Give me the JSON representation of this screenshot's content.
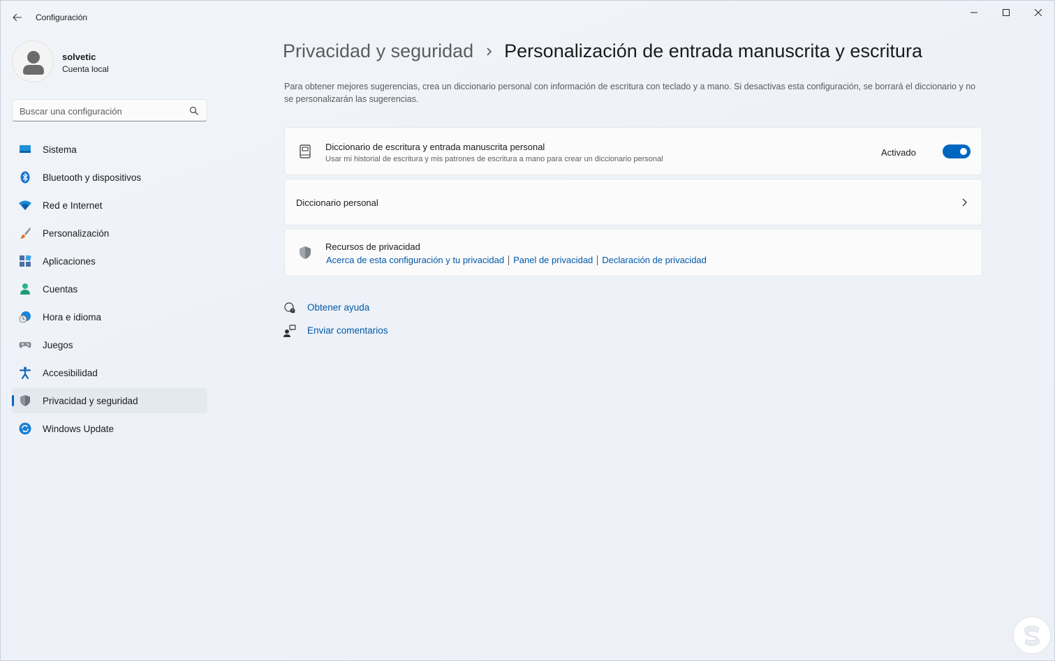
{
  "window": {
    "title": "Configuración"
  },
  "profile": {
    "name": "solvetic",
    "account_type": "Cuenta local"
  },
  "search": {
    "placeholder": "Buscar una configuración"
  },
  "sidebar": {
    "items": [
      {
        "label": "Sistema",
        "icon": "monitor-icon"
      },
      {
        "label": "Bluetooth y dispositivos",
        "icon": "bluetooth-icon"
      },
      {
        "label": "Red e Internet",
        "icon": "wifi-icon"
      },
      {
        "label": "Personalización",
        "icon": "brush-icon"
      },
      {
        "label": "Aplicaciones",
        "icon": "apps-icon"
      },
      {
        "label": "Cuentas",
        "icon": "person-icon"
      },
      {
        "label": "Hora e idioma",
        "icon": "globe-clock-icon"
      },
      {
        "label": "Juegos",
        "icon": "gamepad-icon"
      },
      {
        "label": "Accesibilidad",
        "icon": "accessibility-icon"
      },
      {
        "label": "Privacidad y seguridad",
        "icon": "shield-icon",
        "active": true
      },
      {
        "label": "Windows Update",
        "icon": "sync-icon"
      }
    ]
  },
  "breadcrumb": {
    "parent": "Privacidad y seguridad",
    "current": "Personalización de entrada manuscrita y escritura"
  },
  "description": "Para obtener mejores sugerencias, crea un diccionario personal con información de escritura con teclado y a mano. Si desactivas esta configuración, se borrará el diccionario y no se personalizarán las sugerencias.",
  "settings": {
    "dictionary_toggle": {
      "title": "Diccionario de escritura y entrada manuscrita personal",
      "subtitle": "Usar mi historial de escritura y mis patrones de escritura a mano para crear un diccionario personal",
      "state_label": "Activado",
      "on": true
    },
    "personal_dictionary": {
      "title": "Diccionario personal"
    },
    "privacy_resources": {
      "title": "Recursos de privacidad",
      "links": [
        "Acerca de esta configuración y tu privacidad",
        "Panel de privacidad",
        "Declaración de privacidad"
      ]
    }
  },
  "help": {
    "get_help": "Obtener ayuda",
    "feedback": "Enviar comentarios"
  },
  "colors": {
    "accent": "#0067c0",
    "link": "#0058a8"
  }
}
